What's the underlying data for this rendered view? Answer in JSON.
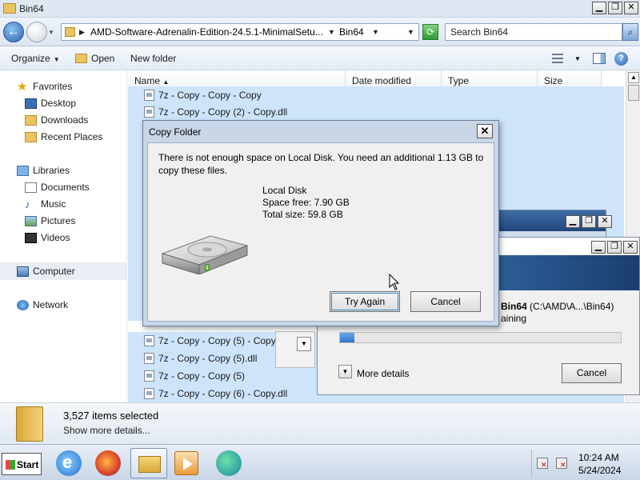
{
  "window": {
    "title": "Bin64"
  },
  "address": {
    "crumb1": "AMD-Software-Adrenalin-Edition-24.5.1-MinimalSetu...",
    "crumb2": "Bin64",
    "search_placeholder": "Search Bin64"
  },
  "toolbar": {
    "organize": "Organize",
    "open": "Open",
    "new_folder": "New folder"
  },
  "nav": {
    "favorites": "Favorites",
    "desktop": "Desktop",
    "downloads": "Downloads",
    "recent": "Recent Places",
    "libraries": "Libraries",
    "documents": "Documents",
    "music": "Music",
    "pictures": "Pictures",
    "videos": "Videos",
    "computer": "Computer",
    "network": "Network"
  },
  "columns": {
    "name": "Name",
    "date": "Date modified",
    "type": "Type",
    "size": "Size"
  },
  "files_top": [
    "7z - Copy - Copy - Copy",
    "7z - Copy - Copy (2) - Copy.dll"
  ],
  "files_bottom": [
    "7z - Copy - Copy (5) - Copy",
    "7z - Copy - Copy (5).dll",
    "7z - Copy - Copy (5)",
    "7z - Copy - Copy (6) - Copy.dll"
  ],
  "details": {
    "count": "3,527 items selected",
    "more": "Show more details..."
  },
  "dialog": {
    "title": "Copy Folder",
    "message": "There is not enough space on Local Disk. You need an additional 1.13 GB to copy these files.",
    "disk_name": "Local Disk",
    "space_free": "Space free: 7.90 GB",
    "total_size": "Total size: 59.8 GB",
    "try_again": "Try Again",
    "cancel": "Cancel"
  },
  "progress": {
    "dest_bold": "Bin64",
    "dest_path": "(C:\\AMD\\A...\\Bin64)",
    "remaining": "aining",
    "fraction": 0.05,
    "more_details": "More details",
    "cancel": "Cancel"
  },
  "taskbar": {
    "start": "Start",
    "time": "10:24 AM",
    "date": "5/24/2024"
  }
}
